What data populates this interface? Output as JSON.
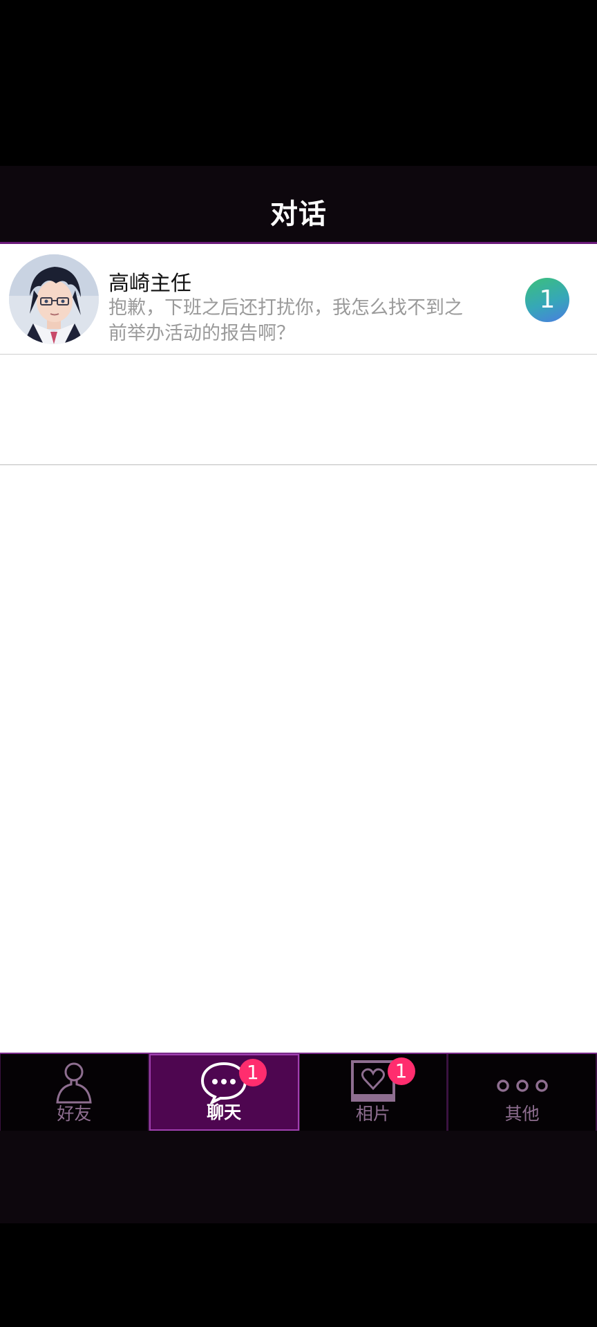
{
  "header": {
    "title": "对话"
  },
  "chats": [
    {
      "name": "高崎主任",
      "preview": "抱歉，下班之后还打扰你，我怎么找不到之前举办活动的报告啊？",
      "unread": "1",
      "avatar_icon": "character-avatar"
    }
  ],
  "tabs": [
    {
      "label": "好友",
      "icon": "person-icon",
      "badge": "",
      "active": false
    },
    {
      "label": "聊天",
      "icon": "chat-bubble-icon",
      "badge": "1",
      "active": true
    },
    {
      "label": "相片",
      "icon": "photo-heart-icon",
      "badge": "1",
      "active": false
    },
    {
      "label": "其他",
      "icon": "more-dots-icon",
      "badge": "",
      "active": false
    }
  ],
  "colors": {
    "accent_purple": "#4e0650",
    "badge_pink": "#ff2d6e",
    "unread_green": "#3cc07a"
  }
}
